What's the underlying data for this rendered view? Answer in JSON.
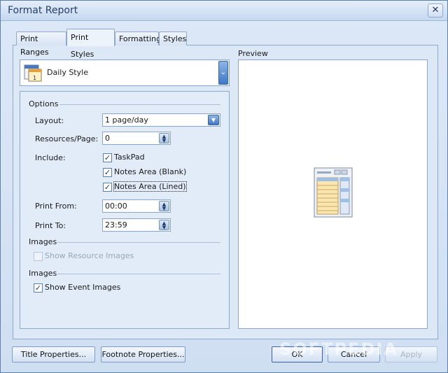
{
  "window": {
    "title": "Format Report"
  },
  "tabs": [
    {
      "label": "Print Ranges",
      "active": false
    },
    {
      "label": "Print Styles",
      "active": true
    },
    {
      "label": "Formatting",
      "active": false
    },
    {
      "label": "Styles",
      "active": false
    }
  ],
  "style_select": {
    "value": "Daily Style",
    "icon": "calendar-icon"
  },
  "options": {
    "section_title": "Options",
    "layout": {
      "label": "Layout:",
      "value": "1 page/day"
    },
    "resources_per_page": {
      "label": "Resources/Page:",
      "value": "0"
    },
    "include": {
      "label": "Include:",
      "items": [
        {
          "label": "TaskPad",
          "checked": true
        },
        {
          "label": "Notes Area (Blank)",
          "checked": true
        },
        {
          "label": "Notes Area (Lined)",
          "checked": true
        }
      ]
    },
    "print_from": {
      "label": "Print From:",
      "value": "00:00"
    },
    "print_to": {
      "label": "Print To:",
      "value": "23:59"
    },
    "images_section_1": {
      "title": "Images",
      "show_resource_images": {
        "label": "Show Resource Images",
        "checked": false,
        "enabled": false
      }
    },
    "images_section_2": {
      "title": "Images",
      "show_event_images": {
        "label": "Show Event Images",
        "checked": true,
        "enabled": true
      }
    }
  },
  "preview": {
    "label": "Preview",
    "icon": "report-preview-icon"
  },
  "buttons": {
    "title_properties": "Title Properties...",
    "footnote_properties": "Footnote Properties...",
    "ok": "OK",
    "cancel": "Cancel",
    "apply": "Apply"
  },
  "watermark": "SOFTPEDIA",
  "colors": {
    "accent": "#3e78c9",
    "background": "#dde8f6",
    "border": "#8fa9cc"
  }
}
